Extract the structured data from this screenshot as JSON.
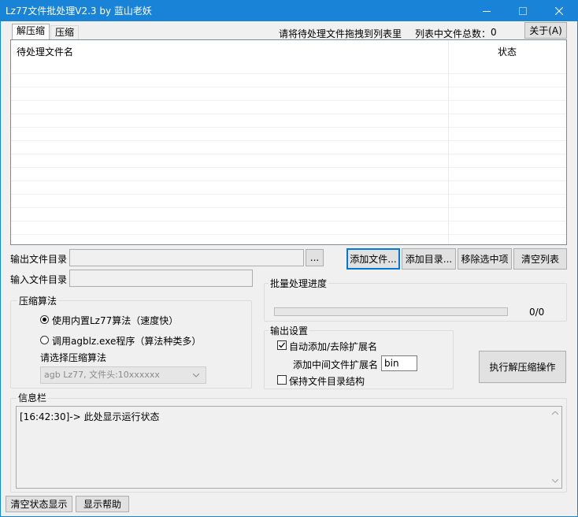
{
  "window": {
    "title": "Lz77文件批处理V2.3 by 蓝山老妖"
  },
  "tabs": [
    {
      "label": "解压缩",
      "active": true
    },
    {
      "label": "压缩",
      "active": false
    }
  ],
  "top_info": {
    "drag_hint": "请将待处理文件拖拽到列表里",
    "count_label": "列表中文件总数：",
    "count_value": "0",
    "about_label": "关于(A)"
  },
  "file_list": {
    "columns": [
      "待处理文件名",
      "状态"
    ],
    "rows": []
  },
  "output_dir": {
    "label": "输出文件目录",
    "value": "",
    "browse_label": "..."
  },
  "input_dir": {
    "label": "输入文件目录",
    "value": ""
  },
  "list_buttons": {
    "add_file": "添加文件...",
    "add_dir": "添加目录...",
    "remove_selected": "移除选中项",
    "clear_list": "清空列表"
  },
  "algorithm": {
    "group_label": "压缩算法",
    "option_builtin": "使用内置Lz77算法（速度快）",
    "option_external": "调用agblz.exe程序（算法种类多）",
    "selected": "builtin",
    "select_label": "请选择压缩算法",
    "select_value": "agb Lz77, 文件头:10xxxxxx"
  },
  "progress": {
    "group_label": "批量处理进度",
    "value": 0,
    "total": 0,
    "text": "0/0"
  },
  "output_settings": {
    "group_label": "输出设置",
    "auto_ext_label": "自动添加/去除扩展名",
    "auto_ext_checked": true,
    "mid_ext_label": "添加中间文件扩展名",
    "mid_ext_value": "bin",
    "keep_structure_label": "保持文件目录结构",
    "keep_structure_checked": false
  },
  "execute_button": "执行解压缩操作",
  "info": {
    "group_label": "信息栏",
    "log": [
      "[16:42:30]-> 此处显示运行状态"
    ]
  },
  "bottom_buttons": {
    "clear_status": "清空状态显示",
    "show_help": "显示帮助"
  },
  "colors": {
    "titlebar": "#1883d7",
    "window_bg": "#f0f0f0",
    "focus_border": "#0078d7"
  },
  "icons": [
    "minimize-icon",
    "maximize-icon",
    "close-icon",
    "scroll-up-icon",
    "scroll-down-icon",
    "dropdown-arrow-icon",
    "checkmark-icon"
  ]
}
